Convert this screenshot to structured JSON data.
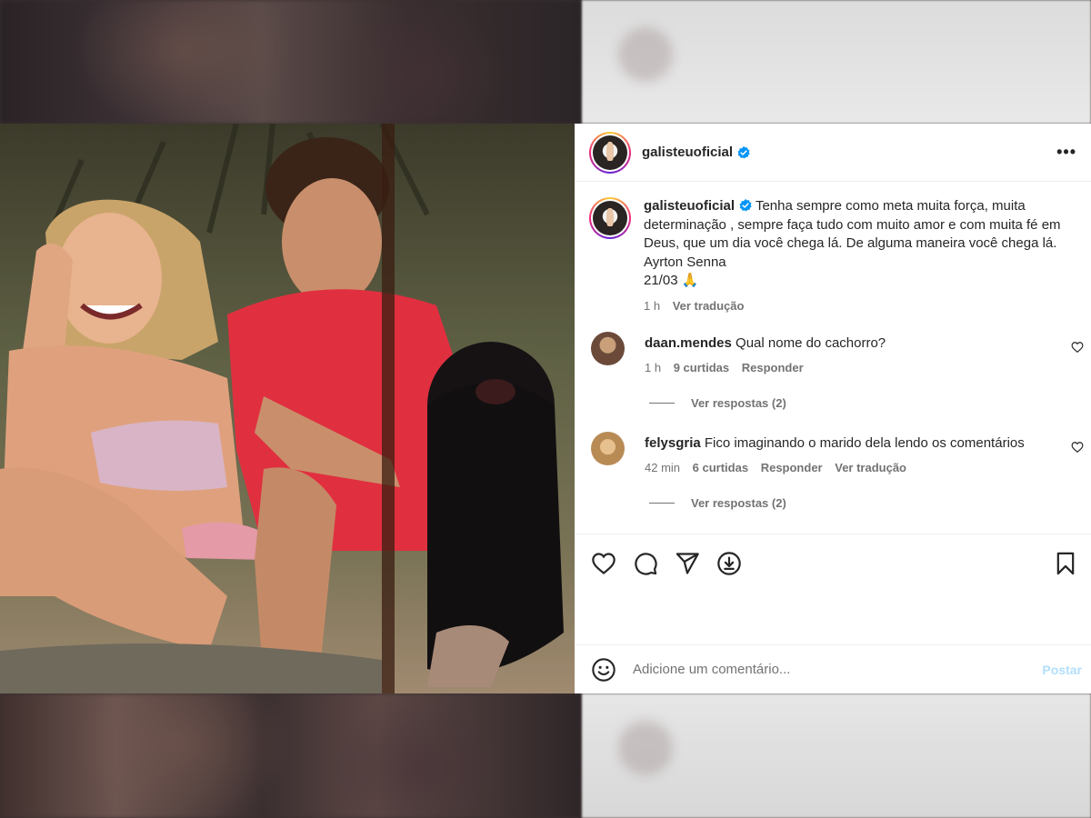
{
  "post": {
    "username": "galisteuoficial",
    "caption_username": "galisteuoficial",
    "caption_text": "Tenha sempre como meta muita força, muita determinação , sempre faça tudo com muito amor e com muita fé em Deus, que um dia você chega lá. De alguma maneira você chega lá. Ayrton Senna",
    "caption_date": "21/03",
    "caption_emoji": "🙏",
    "caption_time": "1 h",
    "caption_translate": "Ver tradução"
  },
  "comments": [
    {
      "username": "daan.mendes",
      "text": "Qual nome do cachorro?",
      "time": "1 h",
      "likes": "9 curtidas",
      "reply": "Responder",
      "translate": "",
      "view_replies": "Ver respostas (2)"
    },
    {
      "username": "felysgria",
      "text": "Fico imaginando o marido dela lendo os comentários",
      "time": "42 min",
      "likes": "6 curtidas",
      "reply": "Responder",
      "translate": "Ver tradução",
      "view_replies": "Ver respostas (2)"
    }
  ],
  "composer": {
    "placeholder": "Adicione um comentário...",
    "post_label": "Postar"
  },
  "icons": {
    "more": "more-options-icon",
    "verified": "verified-badge-icon",
    "like": "heart-icon",
    "comment": "comment-icon",
    "share": "send-icon",
    "save_download": "download-icon",
    "bookmark": "bookmark-icon",
    "emoji": "emoji-icon"
  },
  "colors": {
    "text": "#262626",
    "secondary": "#737373",
    "verified": "#0095f6",
    "post_button_disabled": "#b2dffc"
  }
}
